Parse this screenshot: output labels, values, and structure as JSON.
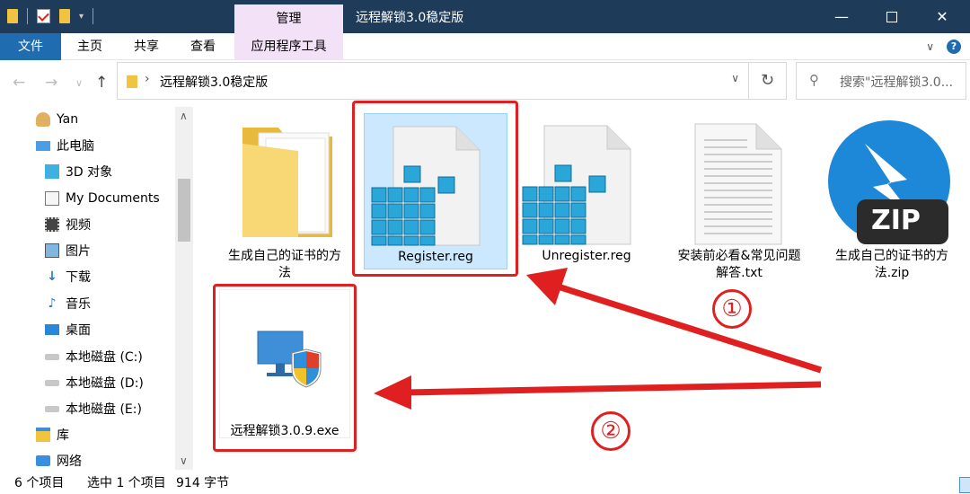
{
  "window": {
    "title": "远程解锁3.0稳定版",
    "context_tab": "管理"
  },
  "ribbon": {
    "tabs": [
      "文件",
      "主页",
      "共享",
      "查看",
      "应用程序工具"
    ]
  },
  "address": {
    "path": "远程解锁3.0稳定版",
    "search_placeholder": "搜索\"远程解锁3.0..."
  },
  "sidebar": {
    "items": [
      {
        "label": "Yan",
        "icon": "user-icon"
      },
      {
        "label": "此电脑",
        "icon": "computer-icon"
      },
      {
        "label": "3D 对象",
        "icon": "cube-icon"
      },
      {
        "label": "My Documents",
        "icon": "document-icon"
      },
      {
        "label": "视频",
        "icon": "video-icon"
      },
      {
        "label": "图片",
        "icon": "picture-icon"
      },
      {
        "label": "下载",
        "icon": "download-icon"
      },
      {
        "label": "音乐",
        "icon": "music-icon"
      },
      {
        "label": "桌面",
        "icon": "desktop-icon"
      },
      {
        "label": "本地磁盘 (C:)",
        "icon": "drive-icon"
      },
      {
        "label": "本地磁盘 (D:)",
        "icon": "drive-icon"
      },
      {
        "label": "本地磁盘 (E:)",
        "icon": "drive-icon"
      },
      {
        "label": "库",
        "icon": "library-icon"
      },
      {
        "label": "网络",
        "icon": "network-icon"
      }
    ]
  },
  "files": [
    {
      "name": "生成自己的证书的方法",
      "line1": "生成自己的证书的方",
      "line2": "法",
      "icon": "folder-icon"
    },
    {
      "name": "Register.reg",
      "line1": "Register.reg",
      "line2": "",
      "icon": "registry-icon",
      "selected": true
    },
    {
      "name": "Unregister.reg",
      "line1": "Unregister.reg",
      "line2": "",
      "icon": "registry-icon"
    },
    {
      "name": "安装前必看&常见问题解答.txt",
      "line1": "安装前必看&常见问题",
      "line2": "解答.txt",
      "icon": "text-file-icon"
    },
    {
      "name": "生成自己的证书的方法.zip",
      "line1": "生成自己的证书的方",
      "line2": "法.zip",
      "icon": "zip-icon"
    },
    {
      "name": "远程解锁3.0.9.exe",
      "line1": "远程解锁3.0.9.exe",
      "line2": "",
      "icon": "exe-icon"
    }
  ],
  "annotations": {
    "step1": "①",
    "step2": "②",
    "zip_badge": "ZIP"
  },
  "status": {
    "count": "6 个项目",
    "selection": "选中 1 个项目",
    "size": "914 字节"
  },
  "colors": {
    "titlebar": "#1f3b5a",
    "file_tab": "#1f6cb0",
    "context_tab": "#f3e2f7",
    "selection": "#cce8ff",
    "annotation_red": "#e02020"
  }
}
